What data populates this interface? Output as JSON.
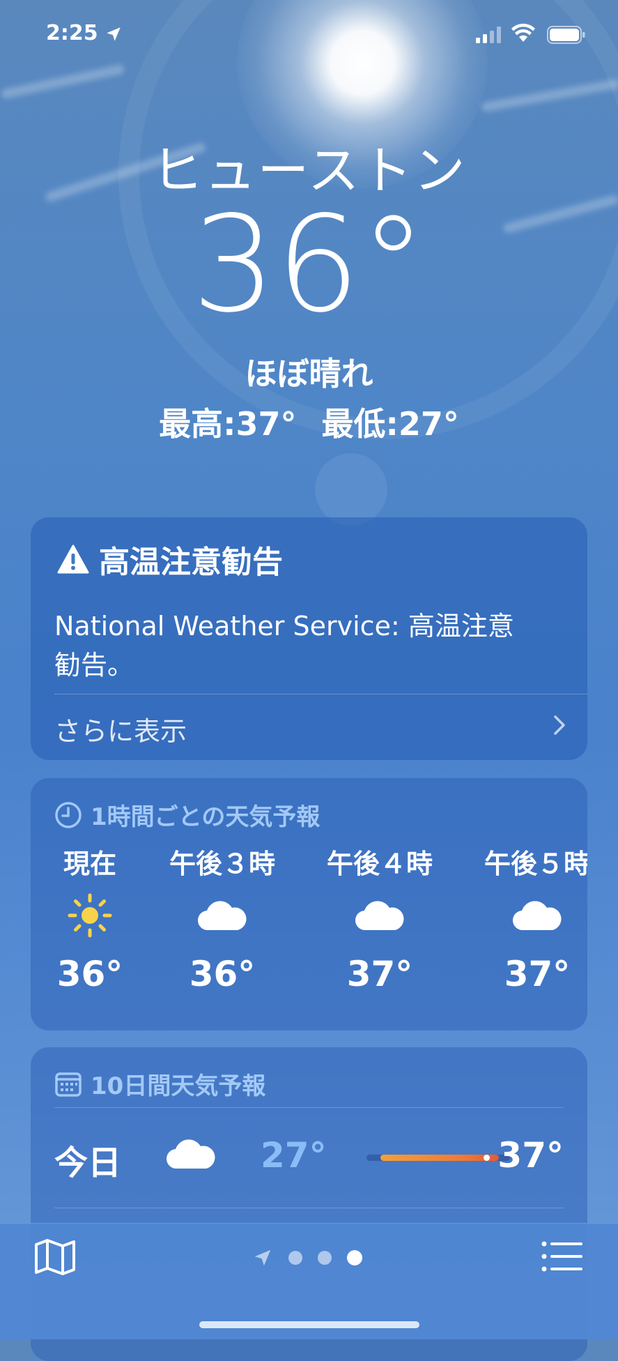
{
  "status_bar": {
    "time": "2:25"
  },
  "header": {
    "city": "ヒューストン",
    "temperature": "36°",
    "condition": "ほぼ晴れ",
    "high": "最高:37°",
    "low": "最低:27°"
  },
  "alert": {
    "title": "高温注意勧告",
    "body": "National Weather Service: 高温注意勧告。",
    "more": "さらに表示"
  },
  "hourly": {
    "title": "1時間ごとの天気予報",
    "items": [
      {
        "label": "現在",
        "icon": "sun-icon",
        "temp": "36°"
      },
      {
        "label": "午後３時",
        "icon": "cloud-icon",
        "temp": "36°"
      },
      {
        "label": "午後４時",
        "icon": "cloud-icon",
        "temp": "37°"
      },
      {
        "label": "午後５時",
        "icon": "cloud-icon",
        "temp": "37°"
      }
    ]
  },
  "daily": {
    "title": "10日間天気予報",
    "rows": [
      {
        "day": "今日",
        "icon": "cloud-icon",
        "low": "27°",
        "high": "37°"
      }
    ]
  },
  "pager": {
    "count": 3,
    "active_index": 2
  },
  "colors": {
    "sun": "#f8d34a",
    "bar_start": "#f4a03a",
    "bar_end": "#e55a32",
    "low_temp": "#96c8ff"
  }
}
